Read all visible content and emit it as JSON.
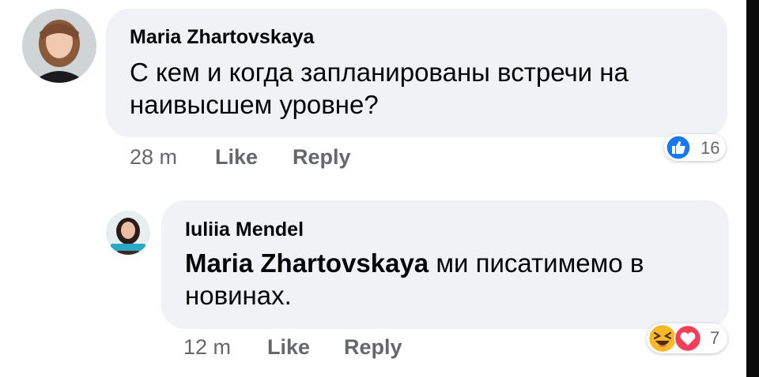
{
  "comments": [
    {
      "author": "Maria Zhartovskaya",
      "text": "С кем и когда запланированы встречи на наивысшем уровне?",
      "time": "28 m",
      "like_label": "Like",
      "reply_label": "Reply",
      "reaction_count": "16",
      "reactions": [
        "like-icon"
      ]
    },
    {
      "author": "Iuliia Mendel",
      "mention": "Maria Zhartovskaya",
      "text": " ми писатимемо в новинах.",
      "time": "12 m",
      "like_label": "Like",
      "reply_label": "Reply",
      "reaction_count": "7",
      "reactions": [
        "haha-icon",
        "love-icon"
      ]
    }
  ],
  "colors": {
    "bubble": "#f0f2f5",
    "meta_text": "#65676b",
    "like_blue": "#1877f2",
    "love_red": "#f33e58",
    "haha_yellow": "#f7b928"
  }
}
